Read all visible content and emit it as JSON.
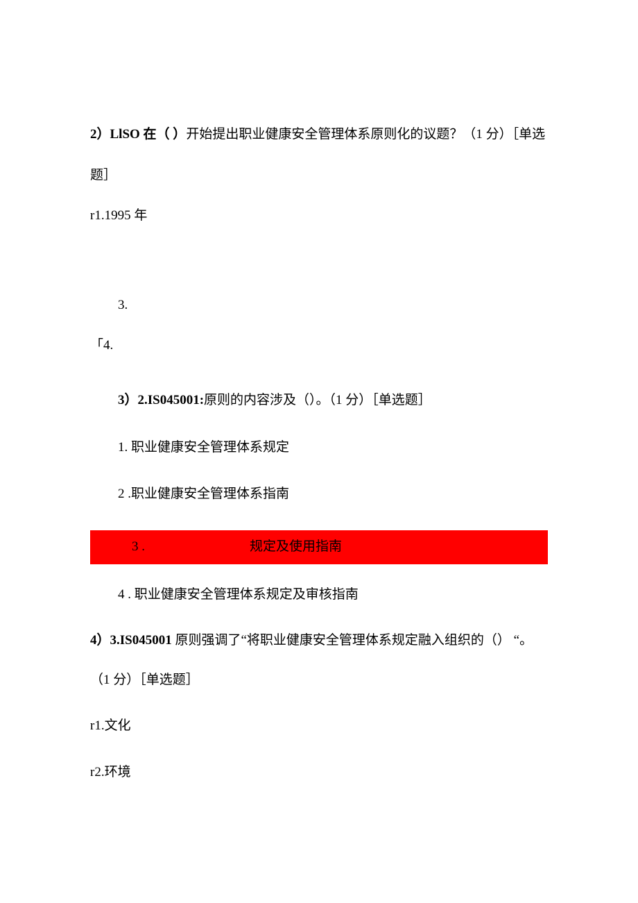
{
  "q2": {
    "stem_prefix": "2）LlSO 在（ ）",
    "stem_rest": "开始提出职业健康安全管理体系原则化的议题？（1 分）［单选",
    "stem_line2": "题］",
    "opt1": "r1.1995 年",
    "opt3": "3.",
    "opt4": "「4."
  },
  "q3": {
    "stem_prefix": "3）2.IS045001:",
    "stem_rest": "原则的内容涉及（）。（1 分）［单选题］",
    "opt1": "1. 职业健康安全管理体系规定",
    "opt2": "2 .职业健康安全管理体系指南",
    "opt3_num": "3 .",
    "opt3_text": "规定及使用指南",
    "opt4": "4 . 职业健康安全管理体系规定及审核指南"
  },
  "q4": {
    "stem1_prefix": "4）3.IS045001",
    "stem1_rest": " 原则强调了“将职业健康安全管理体系规定融入组织的（） “。",
    "stem2": "（1 分）［单选题］",
    "opt1": "r1.文化",
    "opt2": "r2.环境"
  }
}
